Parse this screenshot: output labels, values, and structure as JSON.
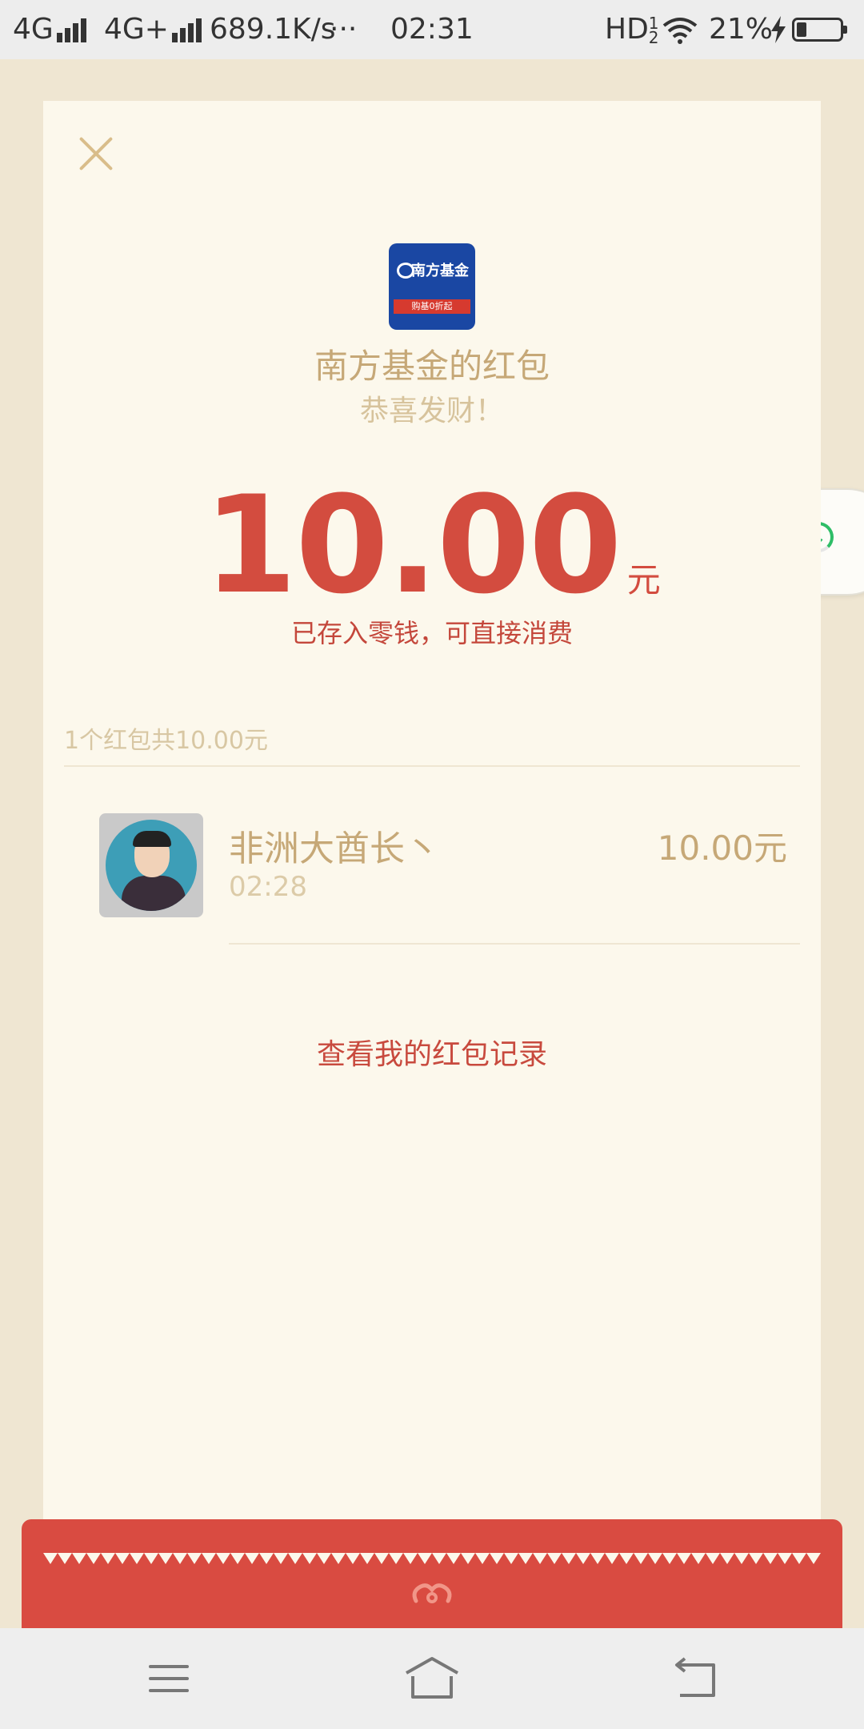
{
  "status_bar": {
    "network1": "4G",
    "network2": "4G+",
    "speed": "689.1K/s",
    "dots": "···",
    "time": "02:31",
    "hd": "HD",
    "hd_sup": "1",
    "hd_sub": "2",
    "battery": "21%"
  },
  "card": {
    "logo": {
      "name": "南方基金",
      "ribbon": "购基0折起"
    },
    "title": "南方基金的红包",
    "wish": "恭喜发财！",
    "amount": "10.00",
    "unit": "元",
    "saved_note": "已存入零钱，可直接消费",
    "summary": "1个红包共10.00元",
    "record": {
      "name": "非洲大酋长丶",
      "time": "02:28",
      "amount": "10.00元"
    },
    "history_link": "查看我的红包记录"
  },
  "colors": {
    "accent_red": "#d34c3f",
    "gold": "#c6a877",
    "card_bg": "#fcf8ec",
    "page_bg": "#efe6d2",
    "download_green": "#2ebd67"
  },
  "icons": {
    "close": "close-icon",
    "download": "download-icon",
    "menu": "menu-icon",
    "home": "home-icon",
    "back": "back-icon"
  }
}
